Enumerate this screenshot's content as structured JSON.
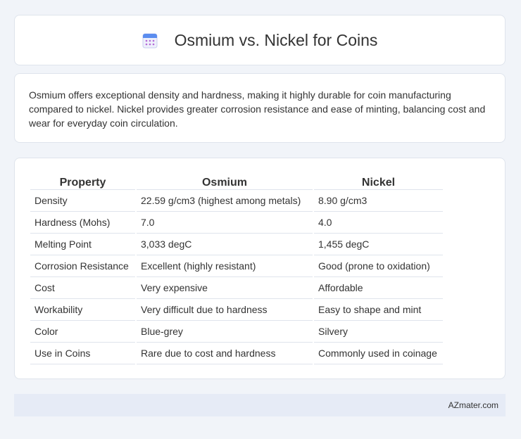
{
  "header": {
    "title": "Osmium vs. Nickel for Coins",
    "icon": "calendar-icon"
  },
  "summary": {
    "text": "Osmium offers exceptional density and hardness, making it highly durable for coin manufacturing compared to nickel. Nickel provides greater corrosion resistance and ease of minting, balancing cost and wear for everyday coin circulation."
  },
  "table": {
    "headers": [
      "Property",
      "Osmium",
      "Nickel"
    ],
    "rows": [
      [
        "Density",
        "22.59 g/cm3 (highest among metals)",
        "8.90 g/cm3"
      ],
      [
        "Hardness (Mohs)",
        "7.0",
        "4.0"
      ],
      [
        "Melting Point",
        "3,033 degC",
        "1,455 degC"
      ],
      [
        "Corrosion Resistance",
        "Excellent (highly resistant)",
        "Good (prone to oxidation)"
      ],
      [
        "Cost",
        "Very expensive",
        "Affordable"
      ],
      [
        "Workability",
        "Very difficult due to hardness",
        "Easy to shape and mint"
      ],
      [
        "Color",
        "Blue-grey",
        "Silvery"
      ],
      [
        "Use in Coins",
        "Rare due to cost and hardness",
        "Commonly used in coinage"
      ]
    ]
  },
  "footer": {
    "text": "AZmater.com"
  }
}
